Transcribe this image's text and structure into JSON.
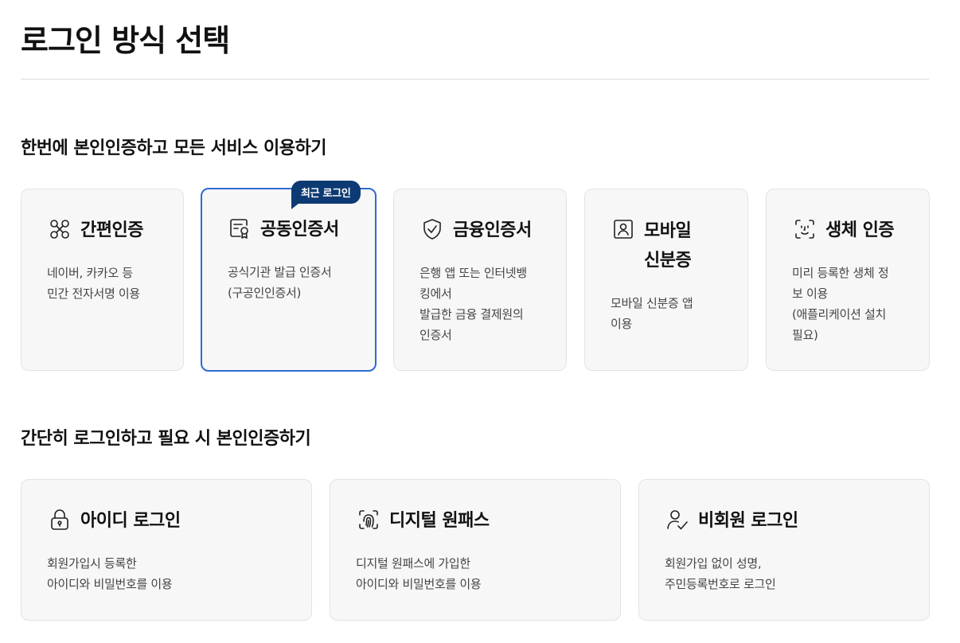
{
  "page": {
    "title": "로그인 방식 선택"
  },
  "section1": {
    "title": "한번에 본인인증하고 모든 서비스 이용하기",
    "cards": [
      {
        "icon": "simple-auth-icon",
        "title": "간편인증",
        "desc": "네이버, 카카오 등\n민간 전자서명 이용"
      },
      {
        "icon": "certificate-icon",
        "title": "공동인증서",
        "desc": "공식기관 발급 인증서\n(구공인인증서)",
        "badge": "최근 로그인"
      },
      {
        "icon": "shield-check-icon",
        "title": "금융인증서",
        "desc": "은행 앱 또는 인터넷뱅\n킹에서\n발급한 금융 결제원의\n인증서"
      },
      {
        "icon": "mobile-id-icon",
        "title": "모바일\n신분증",
        "desc": "모바일 신분증 앱\n이용"
      },
      {
        "icon": "face-scan-icon",
        "title": "생체 인증",
        "desc": "미리 등록한 생체 정\n보 이용\n(애플리케이션 설치\n필요)"
      }
    ]
  },
  "section2": {
    "title": "간단히 로그인하고 필요 시 본인인증하기",
    "cards": [
      {
        "icon": "lock-icon",
        "title": "아이디 로그인",
        "desc": "회원가입시 등록한\n아이디와 비밀번호를 이용"
      },
      {
        "icon": "fingerprint-icon",
        "title": "디지털 원패스",
        "desc": "디지털 원패스에 가입한\n아이디와 비밀번호를 이용"
      },
      {
        "icon": "user-check-icon",
        "title": "비회원 로그인",
        "desc": "회원가입 없이 성명,\n주민등록번호로 로그인"
      }
    ]
  }
}
